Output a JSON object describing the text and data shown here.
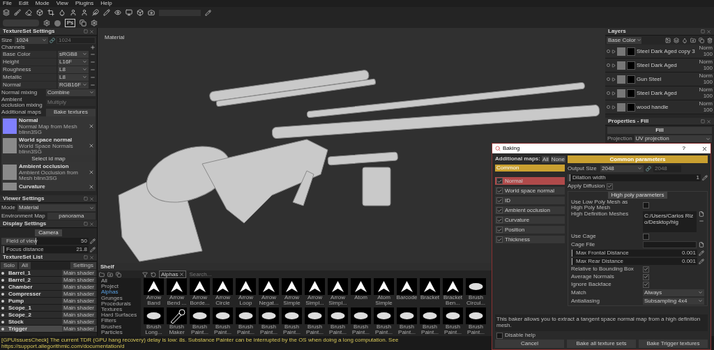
{
  "menu": [
    "File",
    "Edit",
    "Mode",
    "View",
    "Plugins",
    "Help"
  ],
  "toolbar": {
    "ps_label": "Ps"
  },
  "textureset_settings": {
    "title": "TextureSet Settings",
    "size_label": "Size",
    "size": "1024",
    "size_linked": "1024",
    "channels_label": "Channels",
    "channels": [
      {
        "name": "Base Color",
        "format": "sRGB8"
      },
      {
        "name": "Height",
        "format": "L16F"
      },
      {
        "name": "Roughness",
        "format": "L8"
      },
      {
        "name": "Metallic",
        "format": "L8"
      },
      {
        "name": "Normal",
        "format": "RGB16F"
      }
    ],
    "normal_mixing_label": "Normal mixing",
    "normal_mixing": "Combine",
    "ao_mixing_label": "Ambient occlusion mixing",
    "ao_mixing": "Multiply",
    "additional_maps_label": "Additional maps",
    "bake_button": "Bake textures",
    "maps": [
      {
        "kind": "flat_map",
        "name": "Normal",
        "description": "Normal Map from Mesh blinn3SG"
      },
      {
        "kind": "image_map",
        "name": "World space normal",
        "description": "World Space Normals blinn3SG"
      },
      {
        "kind": "button",
        "name": "Select id map"
      },
      {
        "kind": "image_map",
        "name": "Ambient occlusion",
        "description": "Ambient Occlusion  from Mesh blinn3SG"
      },
      {
        "kind": "image_map",
        "name": "Curvature"
      }
    ]
  },
  "viewer_settings": {
    "title": "Viewer Settings",
    "mode_label": "Mode",
    "mode": "Material",
    "env_label": "Environment Map",
    "env": "panorama"
  },
  "display_settings": {
    "title": "Display Settings",
    "tab": "Camera",
    "sliders": [
      {
        "label": "Field of view",
        "value": "50",
        "level": 0.4
      },
      {
        "label": "Focus distance",
        "value": "21.8",
        "level": 0.03
      }
    ]
  },
  "textureset_list": {
    "title": "TextureSet List",
    "buttons": [
      "Solo",
      "All"
    ],
    "settings": "Settings",
    "rows": [
      {
        "name": "Barrel_1",
        "shader": "Main shader",
        "selected": false
      },
      {
        "name": "Barrel_2",
        "shader": "Main shader",
        "selected": false
      },
      {
        "name": "Chamber",
        "shader": "Main shader",
        "selected": false
      },
      {
        "name": "Compresser",
        "shader": "Main shader",
        "selected": false
      },
      {
        "name": "Pump",
        "shader": "Main shader",
        "selected": false
      },
      {
        "name": "Scope_1",
        "shader": "Main shader",
        "selected": false
      },
      {
        "name": "Scope_2",
        "shader": "Main shader",
        "selected": false
      },
      {
        "name": "Stock",
        "shader": "Main shader",
        "selected": false
      },
      {
        "name": "Trigger",
        "shader": "Main shader",
        "selected": true
      }
    ]
  },
  "viewport": {
    "label": "Material"
  },
  "shelf": {
    "title": "Shelf",
    "categories": [
      {
        "label": "All",
        "selected": false
      },
      {
        "label": "Project",
        "selected": false
      },
      {
        "label": "Alphas",
        "selected": true
      },
      {
        "label": "Grunges",
        "selected": false
      },
      {
        "label": "Procedurals",
        "selected": false
      },
      {
        "label": "Textures",
        "selected": false
      },
      {
        "label": "Hard Surfaces",
        "selected": false
      },
      {
        "label": "Filters",
        "selected": false
      },
      {
        "label": "Brushes",
        "selected": false
      },
      {
        "label": "Particles",
        "selected": false
      }
    ],
    "filter_tag": "Alphas",
    "search_placeholder": "Search...",
    "items": [
      {
        "kind": "shape",
        "label": "Arrow Band"
      },
      {
        "kind": "shape",
        "label": "Arrow Bend ..."
      },
      {
        "kind": "shape",
        "label": "Arrow Borde..."
      },
      {
        "kind": "shape",
        "label": "Arrow Circle"
      },
      {
        "kind": "shape",
        "label": "Arrow Loop"
      },
      {
        "kind": "shape",
        "label": "Arrow Negat..."
      },
      {
        "kind": "shape",
        "label": "Arrow Simple"
      },
      {
        "kind": "shape",
        "label": "Arrow Simpl..."
      },
      {
        "kind": "shape",
        "label": "Arrow Simpl..."
      },
      {
        "kind": "shape",
        "label": "Atom"
      },
      {
        "kind": "shape",
        "label": "Atom Simple"
      },
      {
        "kind": "shape",
        "label": "Barcode"
      },
      {
        "kind": "shape",
        "label": "Bracket"
      },
      {
        "kind": "shape",
        "label": "Bracket Ben..."
      },
      {
        "kind": "brush",
        "label": "Brush Circul..."
      },
      {
        "kind": "brush",
        "label": "Brush Long..."
      },
      {
        "kind": "tool",
        "label": "Brush Maker"
      },
      {
        "kind": "brush",
        "label": "Brush Paint..."
      },
      {
        "kind": "brush",
        "label": "Brush Paint..."
      },
      {
        "kind": "brush",
        "label": "Brush Paint..."
      },
      {
        "kind": "brush",
        "label": "Brush Paint..."
      },
      {
        "kind": "brush",
        "label": "Brush Paint..."
      },
      {
        "kind": "brush",
        "label": "Brush Paint..."
      },
      {
        "kind": "brush",
        "label": "Brush Paint..."
      },
      {
        "kind": "brush",
        "label": "Brush Paint..."
      },
      {
        "kind": "brush",
        "label": "Brush Paint..."
      },
      {
        "kind": "brush",
        "label": "Brush Paint..."
      },
      {
        "kind": "brush",
        "label": "Brush Paint..."
      },
      {
        "kind": "brush",
        "label": "Brush Paint..."
      },
      {
        "kind": "brush",
        "label": "Brush Paint..."
      }
    ]
  },
  "status_bar": "[GPUIssuesCheck] The current TDR (GPU hang recovery) delay is low: 8s. Substance Painter can be interrupted by the OS when doing a long computation. See https://support.allegorithmic.com/documentation/d",
  "layers": {
    "title": "Layers",
    "channel": "Base Color",
    "rows": [
      {
        "name": "Steel Dark Aged copy 3",
        "blend": "Norm",
        "opacity": "100"
      },
      {
        "name": "Steel Dark Aged",
        "blend": "Norm",
        "opacity": "100"
      },
      {
        "name": "Gun Steel",
        "blend": "Norm",
        "opacity": "100"
      },
      {
        "name": "Steel Dark Aged",
        "blend": "Norm",
        "opacity": "100"
      },
      {
        "name": "wood handle",
        "blend": "Norm",
        "opacity": "100"
      }
    ]
  },
  "properties": {
    "title": "Properties - Fill",
    "fill_button": "Fill",
    "projection_label": "Projection",
    "projection": "UV projection"
  },
  "baking": {
    "title": "Baking",
    "help_button": "?",
    "additional_maps_label": "Additional maps:",
    "all": "All",
    "none": "None",
    "common": {
      "label": "Common",
      "selected": true
    },
    "maps": [
      {
        "label": "Normal",
        "checked": true,
        "selected": true
      },
      {
        "label": "World space normal",
        "checked": true,
        "selected": false
      },
      {
        "label": "ID",
        "checked": true,
        "selected": false
      },
      {
        "label": "Ambient occlusion",
        "checked": true,
        "selected": false
      },
      {
        "label": "Curvature",
        "checked": true,
        "selected": false
      },
      {
        "label": "Position",
        "checked": true,
        "selected": false
      },
      {
        "label": "Thickness",
        "checked": true,
        "selected": false
      }
    ],
    "section_title": "Common parameters",
    "params": [
      {
        "kind": "size",
        "label": "Output Size",
        "value": "2048",
        "linked": "2048"
      },
      {
        "kind": "slider",
        "label": "Dilation width",
        "value": "1",
        "level": 0.02
      },
      {
        "kind": "check",
        "label": "Apply Diffusion",
        "checked": true
      },
      {
        "kind": "section",
        "label": "High poly parameters"
      },
      {
        "kind": "check",
        "label": "Use Low Poly Mesh as High Poly Mesh",
        "checked": false
      },
      {
        "kind": "files",
        "label": "High Definition Meshes",
        "value": "C:/Users/Carlos Rizo/Desktop/hig"
      },
      {
        "kind": "check",
        "label": "Use Cage",
        "checked": false
      },
      {
        "kind": "file",
        "label": "Cage File"
      },
      {
        "kind": "slider",
        "label": "Max Frontal Distance",
        "value": "0.001",
        "level": 0.01
      },
      {
        "kind": "slider",
        "label": "Max Rear Distance",
        "value": "0.001",
        "level": 0.01
      },
      {
        "kind": "check",
        "label": "Relative to Bounding Box",
        "checked": true
      },
      {
        "kind": "check",
        "label": "Average Normals",
        "checked": true
      },
      {
        "kind": "check",
        "label": "Ignore Backface",
        "checked": true
      },
      {
        "kind": "dropdown",
        "label": "Match",
        "value": "Always"
      },
      {
        "kind": "dropdown",
        "label": "Antialiasing",
        "value": "Subsampling 4x4"
      }
    ],
    "help_text": "This baker allows you to extract a tangent space normal map from a high definition mesh.",
    "disable_help": {
      "label": "Disable help",
      "checked": false
    },
    "buttons": [
      "Cancel",
      "Bake all texture sets",
      "Bake Trigger textures"
    ]
  }
}
